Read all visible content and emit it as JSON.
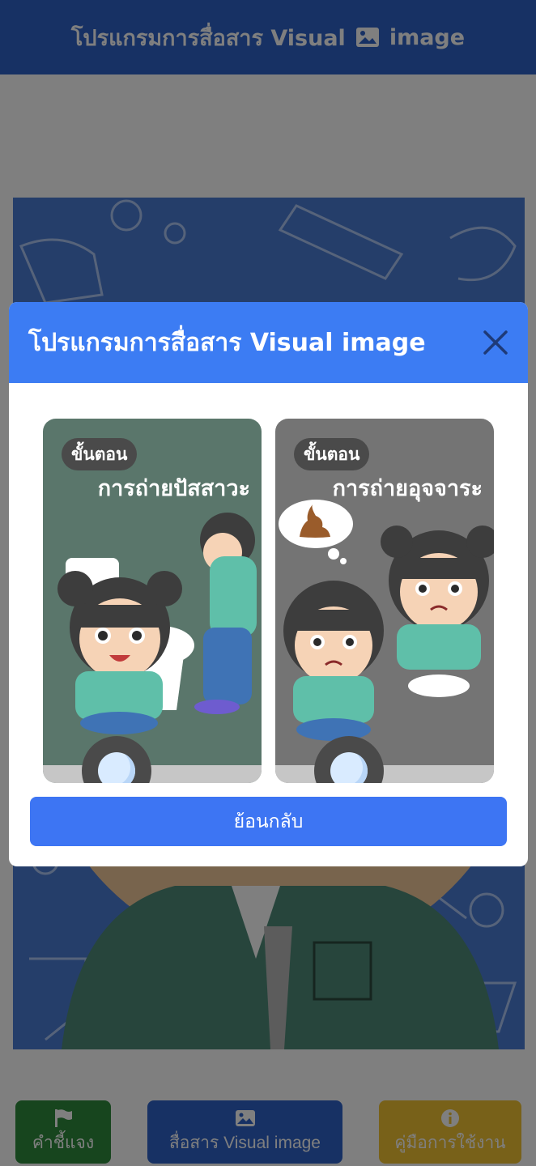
{
  "header": {
    "title": "โปรแกรมการสื่อสาร Visual",
    "title_suffix": "image"
  },
  "bottom_nav": {
    "explain_label": "คำชี้แจง",
    "visual_label": "สื่อสาร Visual image",
    "manual_label": "คู่มือการใช้งาน"
  },
  "modal": {
    "title": "โปรแกรมการสื่อสาร Visual image",
    "cards": [
      {
        "badge": "ขั้นตอน",
        "title": "การถ่ายปัสสาวะ"
      },
      {
        "badge": "ขั้นตอน",
        "title": "การถ่ายอุจจาระ"
      }
    ],
    "back_label": "ย้อนกลับ"
  },
  "colors": {
    "primary": "#2f63c9",
    "modal_header": "#3c7cf3",
    "explain": "#2e8b3d",
    "manual": "#f1c232"
  },
  "icons": [
    "image-icon",
    "close-icon",
    "flag-icon",
    "info-icon"
  ]
}
